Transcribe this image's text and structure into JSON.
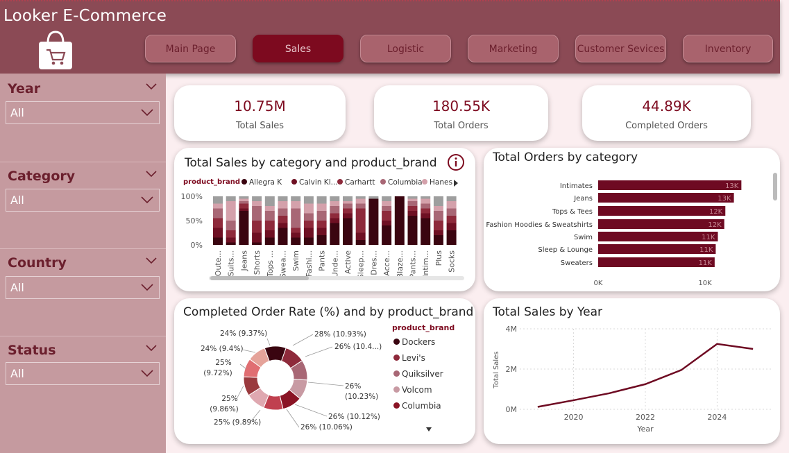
{
  "header": {
    "title": "Looker E-Commerce",
    "nav": [
      "Main Page",
      "Sales",
      "Logistic",
      "Marketing",
      "Customer Sevices",
      "Inventory"
    ],
    "active": "Sales"
  },
  "filters": [
    {
      "label": "Year",
      "value": "All"
    },
    {
      "label": "Category",
      "value": "All"
    },
    {
      "label": "Country",
      "value": "All"
    },
    {
      "label": "Status",
      "value": "All"
    }
  ],
  "kpis": [
    {
      "value": "10.75M",
      "label": "Total Sales"
    },
    {
      "value": "180.55K",
      "label": "Total Orders"
    },
    {
      "value": "44.89K",
      "label": "Completed Orders"
    }
  ],
  "colors": {
    "accent": "#7d0a1f",
    "header": "#8b4a55",
    "sidebar": "#c59a9f",
    "page_bg": "#fbeef0"
  },
  "stacked": {
    "title": "Total Sales by category and product_brand",
    "legend_title": "product_brand",
    "legend": [
      {
        "name": "Allegra K",
        "color": "#3a0510"
      },
      {
        "name": "Calvin Kl...",
        "color": "#6e1023"
      },
      {
        "name": "Carhartt",
        "color": "#8e2a3b"
      },
      {
        "name": "Columbia",
        "color": "#a86775"
      },
      {
        "name": "Hanes",
        "color": "#d4a1ab"
      }
    ],
    "y_ticks": [
      "100%",
      "50%",
      "0%"
    ],
    "categories": [
      "Oute...",
      "Suits...",
      "Jeans",
      "Shorts",
      "Tops ...",
      "Swea...",
      "Swim",
      "Fashi...",
      "Pants",
      "Unde...",
      "Active",
      "Sleep...",
      "Dres...",
      "Acce...",
      "Blaze...",
      "Pants...",
      "Intim...",
      "Plus",
      "Socks"
    ],
    "info_icon": "info-icon"
  },
  "orders_by_category": {
    "title": "Total Orders by category",
    "rows": [
      {
        "category": "Intimates",
        "label": "13K",
        "value": 13.4
      },
      {
        "category": "Jeans",
        "label": "13K",
        "value": 12.7
      },
      {
        "category": "Tops & Tees",
        "label": "12K",
        "value": 11.9
      },
      {
        "category": "Fashion Hoodies & Sweatshirts",
        "label": "12K",
        "value": 11.8
      },
      {
        "category": "Swim",
        "label": "11K",
        "value": 11.2
      },
      {
        "category": "Sleep & Lounge",
        "label": "11K",
        "value": 11.0
      },
      {
        "category": "Sweaters",
        "label": "11K",
        "value": 10.9
      }
    ],
    "x_ticks": [
      "0K",
      "10K"
    ]
  },
  "donut": {
    "title": "Completed Order Rate (%) and by product_brand",
    "legend_title": "product_brand",
    "legend": [
      {
        "name": "Dockers",
        "color": "#3a0510"
      },
      {
        "name": "Levi's",
        "color": "#8e2a3b"
      },
      {
        "name": "Quiksilver",
        "color": "#a86775"
      },
      {
        "name": "Volcom",
        "color": "#c89aa3"
      },
      {
        "name": "Columbia",
        "color": "#8a1425"
      }
    ],
    "labels": [
      "28% (10.93%)",
      "26% (10.4...)",
      "26%",
      "(10.23%)",
      "26% (10.12%)",
      "26% (10.06%)",
      "25% (9.89%)",
      "25%",
      "(9.86%)",
      "25%",
      "(9.72%)",
      "24% (9.4%)",
      "24% (9.37%)"
    ]
  },
  "chart_data": [
    {
      "type": "bar",
      "title": "Total Orders by category",
      "categories": [
        "Intimates",
        "Jeans",
        "Tops & Tees",
        "Fashion Hoodies & Sweatshirts",
        "Swim",
        "Sleep & Lounge",
        "Sweaters"
      ],
      "values": [
        13400,
        12700,
        11900,
        11800,
        11200,
        11000,
        10900
      ],
      "xlim": [
        0,
        16000
      ]
    },
    {
      "type": "line",
      "title": "Total Sales by Year",
      "xlabel": "Year",
      "ylabel": "Total Sales",
      "x": [
        2019,
        2020,
        2021,
        2022,
        2023,
        2024,
        2025
      ],
      "values": [
        120000,
        450000,
        800000,
        1250000,
        1950000,
        3250000,
        3000000
      ],
      "x_ticks": [
        "2020",
        "2022",
        "2024"
      ],
      "y_ticks": [
        "4M",
        "2M",
        "0M"
      ],
      "ylim": [
        0,
        4000000
      ]
    },
    {
      "type": "pie",
      "title": "Completed Order Rate (%) and by product_brand",
      "values": [
        10.93,
        10.4,
        10.23,
        10.12,
        10.06,
        9.89,
        9.86,
        9.72,
        9.4,
        9.37
      ],
      "colors": [
        "#3a0510",
        "#8e2a3b",
        "#a86775",
        "#c89aa3",
        "#8a1425",
        "#c0404f",
        "#dfa8b0",
        "#9a3a3e",
        "#e06e72",
        "#e5a39a"
      ]
    }
  ]
}
